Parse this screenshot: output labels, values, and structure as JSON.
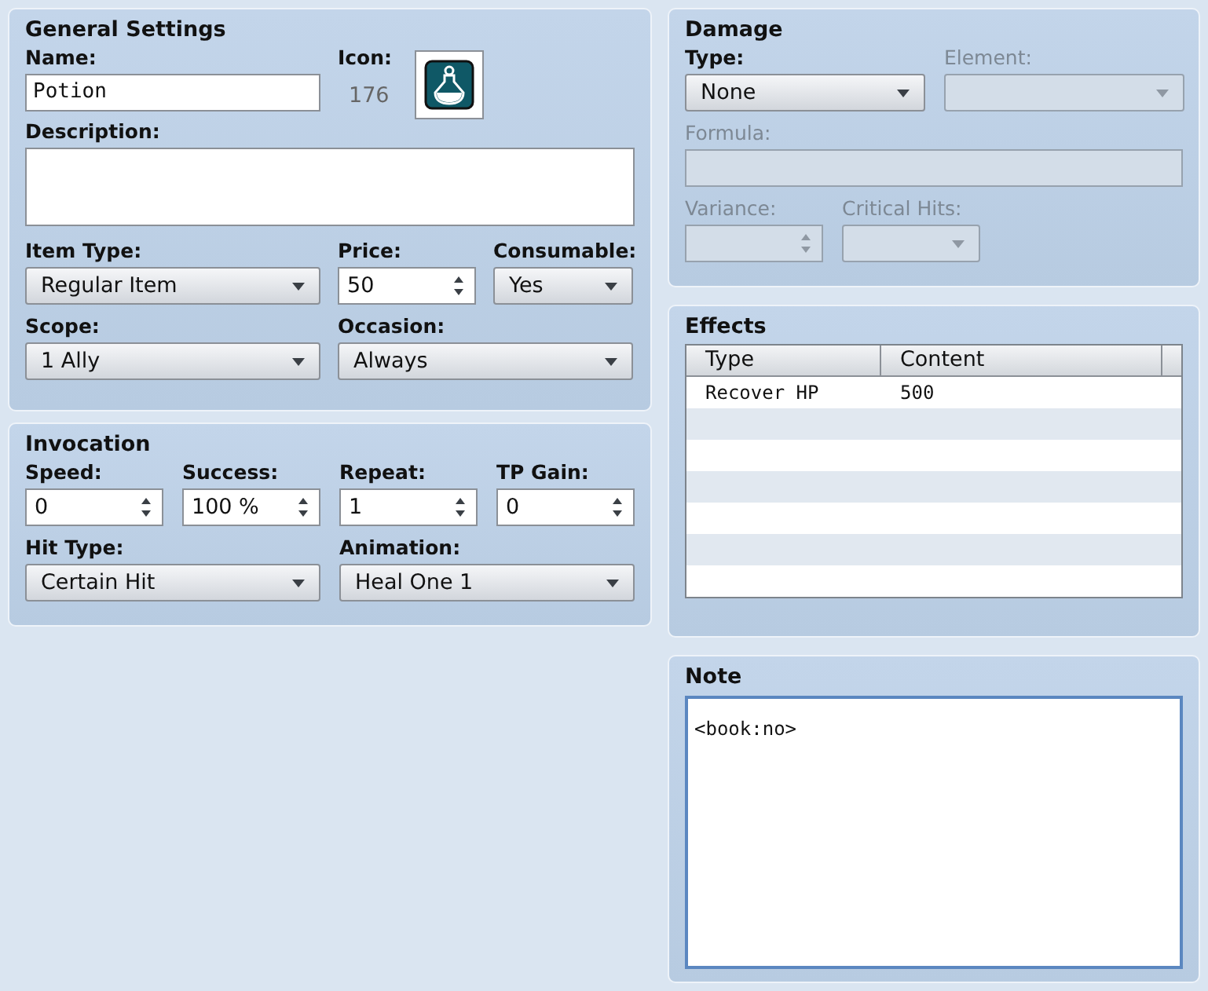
{
  "general": {
    "title": "General Settings",
    "name": {
      "label": "Name:",
      "value": "Potion"
    },
    "icon": {
      "label": "Icon:",
      "number": "176"
    },
    "description": {
      "label": "Description:"
    },
    "item_type": {
      "label": "Item Type:",
      "value": "Regular Item"
    },
    "price": {
      "label": "Price:",
      "value": "50"
    },
    "consumable": {
      "label": "Consumable:",
      "value": "Yes"
    },
    "scope": {
      "label": "Scope:",
      "value": "1 Ally"
    },
    "occasion": {
      "label": "Occasion:",
      "value": "Always"
    }
  },
  "invocation": {
    "title": "Invocation",
    "spins": [
      {
        "label": "Speed:",
        "value": "0"
      },
      {
        "label": "Success:",
        "value": "100 %"
      },
      {
        "label": "Repeat:",
        "value": "1"
      },
      {
        "label": "TP Gain:",
        "value": "0"
      }
    ],
    "hit_type": {
      "label": "Hit Type:",
      "value": "Certain Hit"
    },
    "animation": {
      "label": "Animation:",
      "value": "Heal One 1"
    }
  },
  "damage": {
    "title": "Damage",
    "type": {
      "label": "Type:",
      "value": "None",
      "disabled": false
    },
    "element": {
      "label": "Element:",
      "disabled": true
    },
    "formula": {
      "label": "Formula:",
      "disabled": true
    },
    "variance": {
      "label": "Variance:",
      "disabled": true
    },
    "critical_hits": {
      "label": "Critical Hits:",
      "disabled": true
    }
  },
  "effects": {
    "title": "Effects",
    "columns": [
      "Type",
      "Content"
    ],
    "rows": [
      {
        "type": "Recover HP",
        "content": "500"
      }
    ]
  },
  "note": {
    "title": "Note",
    "value": "<book:no>"
  }
}
